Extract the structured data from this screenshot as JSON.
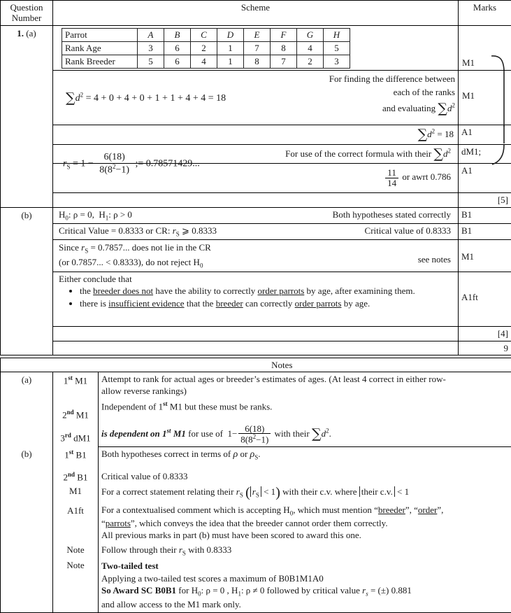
{
  "header": {
    "question_number": "Question\nNumber",
    "question_number_line1": "Question",
    "question_number_line2": "Number",
    "scheme": "Scheme",
    "marks": "Marks"
  },
  "question": {
    "number": "1.",
    "part_a": "(a)",
    "part_b": "(b)"
  },
  "rank_table": {
    "rows": [
      {
        "label": "Parrot",
        "values": [
          "A",
          "B",
          "C",
          "D",
          "E",
          "F",
          "G",
          "H"
        ],
        "italic": true
      },
      {
        "label": "Rank Age",
        "values": [
          "3",
          "6",
          "2",
          "1",
          "7",
          "8",
          "4",
          "5"
        ],
        "italic": false
      },
      {
        "label": "Rank Breeder",
        "values": [
          "5",
          "6",
          "4",
          "1",
          "8",
          "7",
          "2",
          "3"
        ],
        "italic": false
      }
    ]
  },
  "scheme_rows": {
    "sum_d2_working": "= 4 + 0 + 4 + 0 + 1 + 1 + 4 + 4  =  18",
    "m1_comment_l1": "For finding the difference between",
    "m1_comment_l2": "each of the ranks",
    "m1_comment_l3": "and evaluating",
    "a1_comment": "= 18",
    "dm1_comment": "For use of the correct formula with their",
    "a1_frac_num": "11",
    "a1_frac_den": "14",
    "a1_or_awrt": "or awrt 0.786",
    "rs_result": "= 0.78571429...",
    "rs_frac_num": "6(18)",
    "rs_frac_den_pre": "8(8",
    "rs_frac_den_post": "−1)",
    "hypotheses": "H   : ρ = 0,   H   : ρ > 0",
    "h0_label": "H",
    "h0_sub": "0",
    "h0_stmt": ": ρ = 0,",
    "h1_label": "H",
    "h1_sub": "1",
    "h1_stmt": ": ρ > 0",
    "b1_hyp_comment": "Both hypotheses stated correctly",
    "cv_text_pre": "Critical Value = 0.8333  or  CR:",
    "cv_text_post": "⩾ 0.8333",
    "b1_cv_comment": "Critical value of 0.8333",
    "since_pre": "Since",
    "since_post": "= 0.7857... does not lie in the CR",
    "since_l2": "(or 0.7857... <  0.8333), do not reject H",
    "since_l2_sub": "0",
    "m1_see_notes": "see notes",
    "conclude_intro": "Either conclude that",
    "bullets": [
      {
        "segments": [
          {
            "t": "the ",
            "u": false
          },
          {
            "t": "breeder does not",
            "u": true
          },
          {
            "t": " have the ability to correctly ",
            "u": false
          },
          {
            "t": "order parrots",
            "u": true
          },
          {
            "t": " by age, after examining them.",
            "u": false
          }
        ]
      },
      {
        "segments": [
          {
            "t": "there is ",
            "u": false
          },
          {
            "t": "insufficient evidence",
            "u": true
          },
          {
            "t": " that the ",
            "u": false
          },
          {
            "t": "breeder",
            "u": true
          },
          {
            "t": " can correctly ",
            "u": false
          },
          {
            "t": "order parrots",
            "u": true
          },
          {
            "t": " by age.",
            "u": false
          }
        ]
      }
    ]
  },
  "marks": {
    "m1_a": "M1",
    "m1_b": "M1",
    "a1_a": "A1",
    "dm1": "dM1;",
    "a1_b": "A1",
    "total_a": "[5]",
    "b1_hyp": "B1",
    "b1_cv": "B1",
    "m1_concl": "M1",
    "a1ft": "A1ft",
    "total_b": "[4]",
    "grand_total": "9"
  },
  "notes": {
    "title": "Notes",
    "rows": [
      {
        "part": "(a)",
        "code": "1",
        "code_sup": "st",
        "code_rest": " M1",
        "lines": [
          "Attempt to rank for actual ages or breeder’s estimates of ages. (At least 4 correct in either row-",
          "allow reverse rankings)"
        ]
      },
      {
        "part": "",
        "code": "2",
        "code_sup": "nd",
        "code_rest": " M1",
        "lines": [
          "Independent of 1st M1 but these must be ranks."
        ]
      },
      {
        "part": "",
        "code": "3",
        "code_sup": "rd",
        "code_rest": " dM1",
        "lines": [
          "is dependent on 1st M1 for use of"
        ],
        "bold_italic_prefix": "is dependent on 1",
        "bi_sup": "st",
        "bi_rest": " M1",
        "after": "for use of",
        "tail": "with their"
      },
      {
        "part": "(b)",
        "code": "1",
        "code_sup": "st",
        "code_rest": " B1",
        "lines": [
          "Both hypotheses correct in terms of ρ or ρ"
        ],
        "sub": "S",
        "end": "."
      },
      {
        "part": "",
        "code": "2",
        "code_sup": "nd",
        "code_rest": " B1",
        "lines": [
          "Critical value of 0.8333"
        ]
      },
      {
        "part": "",
        "code": "M1",
        "code_sup": "",
        "code_rest": "",
        "lines": [
          "For a correct statement relating their"
        ],
        "mid": "with their c.v. where",
        "tail": "< 1",
        "abs_text": "their c.v."
      },
      {
        "part": "",
        "code": "A1ft",
        "code_sup": "",
        "code_rest": "",
        "lines": [
          "For a contextualised comment which is accepting H0, which must mention “breeder”, “order”,",
          "“parrots”, which conveys the idea that the breeder cannot order them correctly.",
          "All previous marks in part (b) must have been scored to award this one."
        ]
      },
      {
        "part": "",
        "code": "Note",
        "code_sup": "",
        "code_rest": "",
        "lines": [
          "Follow through their"
        ],
        "tail": "with 0.8333"
      },
      {
        "part": "",
        "code": "Note",
        "code_sup": "",
        "code_rest": "",
        "lines": [
          "Two-tailed test",
          "Applying a two-tailed test scores a maximum of B0B1M1A0",
          "So Award SC B0B1 for",
          "and allow access to the M1 mark only."
        ]
      }
    ],
    "a1ft_detail": {
      "l1_a": "For a contextualised comment which is accepting H",
      "l1_sub": "0",
      "l1_b": ", which must mention “",
      "l1_u1": "breeder",
      "l1_c": "”, “",
      "l1_u2": "order",
      "l1_d": "”,",
      "l2_a": "“",
      "l2_u": "parrots",
      "l2_b": "”, which conveys the idea that the breeder cannot order them correctly.",
      "l3": "All previous marks in part (b) must have been scored to award this one."
    },
    "two_tailed": {
      "title": "Two-tailed test",
      "line2": "Applying a two-tailed test scores a maximum of B0B1M1A0",
      "line3_bold": "So Award SC B0B1",
      "line3_a": "for",
      "line3_h0": "H",
      "line3_h0_sub": "0",
      "line3_h0_rest": ": ρ = 0 ,",
      "line3_h1": "H",
      "line3_h1_sub": "1",
      "line3_h1_rest": ": ρ ≠ 0",
      "line3_b": "followed by critical value",
      "line3_rs": "r",
      "line3_rs_sub": "s",
      "line3_val": "= (±) 0.881",
      "line4": "and allow access to the M1 mark only."
    },
    "m1_detail": {
      "pre": "For a correct statement relating their",
      "mid": "with their c.v. where",
      "abs": "their c.v.",
      "post": "< 1"
    },
    "note_ft": {
      "pre": "Follow through their",
      "post": "with 0.8333"
    },
    "dm1_detail": {
      "bi_1": "is dependent on 1",
      "bi_sup": "st",
      "bi_2": " M1",
      "after": "for use of",
      "tail": "with their"
    },
    "b1_detail": {
      "pre": "Both hypotheses correct in terms of",
      "rho": "ρ",
      "or": "or",
      "rho_s": "ρ",
      "rho_s_sub": "S",
      "end": "."
    },
    "independent_line": {
      "a": "Independent of 1",
      "sup": "st",
      "b": " M1 but these must be ranks."
    }
  },
  "colors": {
    "text": "#1a1a1a",
    "rule": "#000000",
    "dotted": "#555555",
    "background": "#ffffff"
  }
}
